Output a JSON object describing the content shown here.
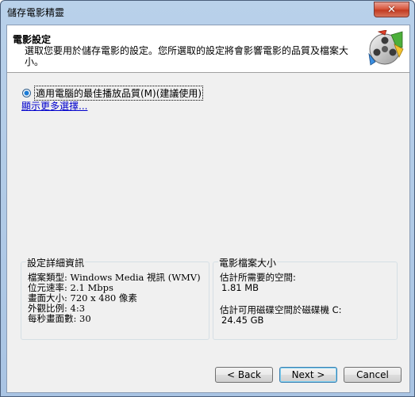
{
  "window": {
    "title": "儲存電影精靈",
    "close_symbol": "✕"
  },
  "header": {
    "title": "電影設定",
    "description": "選取您要用於儲存電影的設定。您所選取的設定將會影響電影的品質及檔案大小。",
    "icon": "film-reel-icon"
  },
  "options": {
    "radio_label": "適用電腦的最佳播放品質(M)(建議使用)",
    "radio_selected": true,
    "more_link": "顯示更多選擇..."
  },
  "details": {
    "legend": "設定詳細資訊",
    "lines": [
      "檔案類型: Windows Media 視訊 (WMV)",
      "位元速率: 2.1 Mbps",
      "畫面大小: 720 x 480 像素",
      "外觀比例: 4:3",
      "每秒畫面數: 30"
    ]
  },
  "filesize": {
    "legend": "電影檔案大小",
    "required_label": "估計所需要的空間:",
    "required_value": "1.81 MB",
    "available_label": "估計可用磁碟空間於磁碟機 C:",
    "available_value": "24.45 GB"
  },
  "buttons": {
    "back": "< Back",
    "next": "Next >",
    "cancel": "Cancel"
  },
  "colors": {
    "link": "#0000cc",
    "close_red": "#c23b22",
    "frame_blue": "#b9d1ea"
  }
}
